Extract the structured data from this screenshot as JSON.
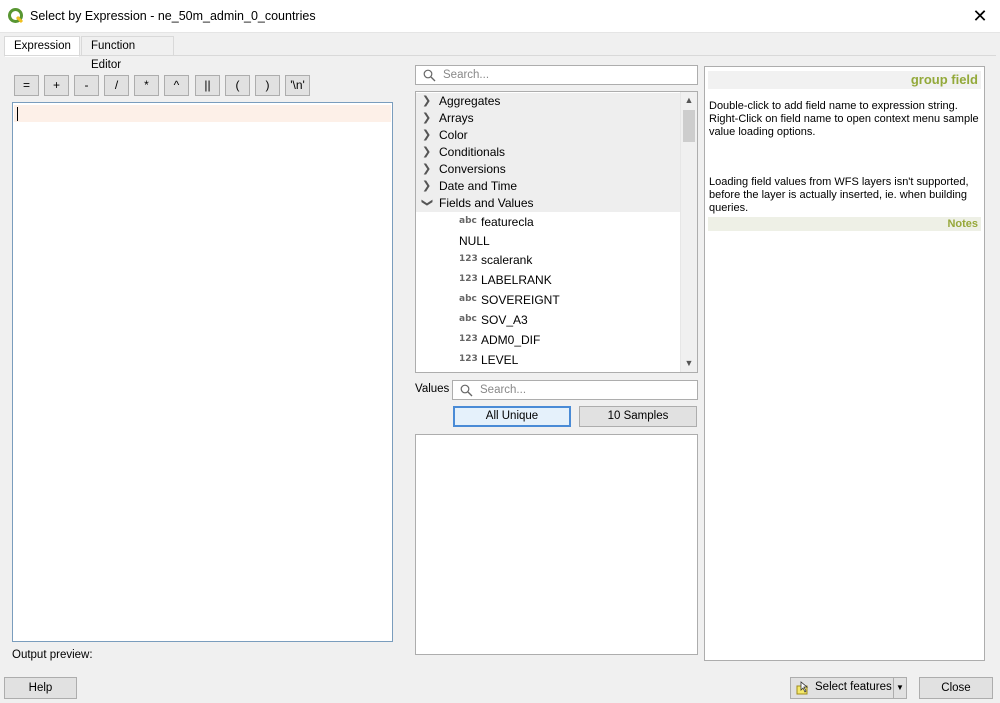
{
  "window": {
    "title": "Select by Expression - ne_50m_admin_0_countries",
    "close_glyph": "✕"
  },
  "tabs": [
    {
      "label": "Expression",
      "active": true
    },
    {
      "label": "Function Editor",
      "active": false
    }
  ],
  "operators": [
    "=",
    "+",
    "-",
    "/",
    "*",
    "^",
    "||",
    "(",
    ")",
    "'\\n'"
  ],
  "output_preview_label": "Output preview:",
  "function_search": {
    "placeholder": "Search..."
  },
  "tree": {
    "groups": [
      {
        "label": "Aggregates",
        "expanded": false
      },
      {
        "label": "Arrays",
        "expanded": false
      },
      {
        "label": "Color",
        "expanded": false
      },
      {
        "label": "Conditionals",
        "expanded": false
      },
      {
        "label": "Conversions",
        "expanded": false
      },
      {
        "label": "Date and Time",
        "expanded": false
      },
      {
        "label": "Fields and Values",
        "expanded": true
      }
    ],
    "fields": [
      {
        "type": "abc",
        "label": "featurecla"
      },
      {
        "type": "",
        "label": "NULL"
      },
      {
        "type": "123",
        "label": "scalerank"
      },
      {
        "type": "123",
        "label": "LABELRANK"
      },
      {
        "type": "abc",
        "label": "SOVEREIGNT"
      },
      {
        "type": "abc",
        "label": "SOV_A3"
      },
      {
        "type": "123",
        "label": "ADM0_DIF"
      },
      {
        "type": "123",
        "label": "LEVEL"
      }
    ]
  },
  "values": {
    "label": "Values",
    "search_placeholder": "Search...",
    "all_unique_label": "All Unique",
    "samples_label": "10 Samples"
  },
  "help": {
    "title": "group field",
    "description": "Double-click to add field name to expression string. Right-Click on field name to open context menu sample value loading options.",
    "notes_heading": "Notes",
    "notes_text": "Loading field values from WFS layers isn't supported, before the layer is actually inserted, ie. when building queries."
  },
  "footer": {
    "help_label": "Help",
    "select_features_label": "Select features",
    "close_label": "Close"
  },
  "colors": {
    "accent": "#93a93a",
    "focus": "#4a8bd6"
  }
}
